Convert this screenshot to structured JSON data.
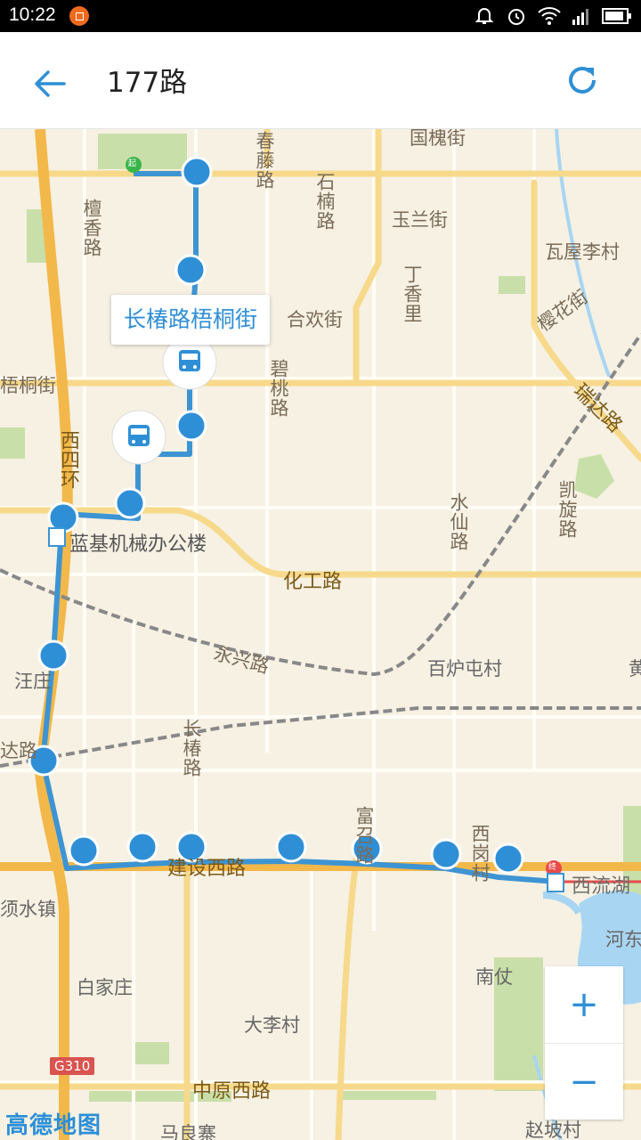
{
  "status": {
    "time": "10:22"
  },
  "header": {
    "title": "177路"
  },
  "map": {
    "callout_label": "长椿路梧桐街",
    "labels": {
      "chunteng": "春藤路",
      "danzhu": "国槐街",
      "shimei": "石楠路",
      "yulan": "玉兰街",
      "waw": "瓦屋李村",
      "tanxiang": "檀香路",
      "hehuan": "合欢街",
      "dingxiang": "丁香里",
      "yinghua": "樱花街",
      "wutong": "梧桐街",
      "ruida": "瑞达路",
      "xisihuan": "西四环",
      "bitao": "碧桃路",
      "kaixuan": "凯旋路",
      "lanji": "蓝基机械办公楼",
      "shuixian": "水仙路",
      "huagong": "化工路",
      "yongxing": "永兴路",
      "bailu": "百炉屯村",
      "huang": "黄",
      "wangzhuang": "汪庄",
      "da": "达路",
      "changchun": "长椿路",
      "fuzhai": "富召路",
      "xigang": "西岗村",
      "jianshe": "建设西路",
      "xiliuhu": "西流湖",
      "xushui": "须水镇",
      "hedong": "河东",
      "baijia": "白家庄",
      "nanzhang": "南仗",
      "dali": "大李村",
      "zhongyuan": "中原西路",
      "maliang": "马良寨",
      "zhaopo": "赵坡村",
      "g310": "G310",
      "logo": "高德地图",
      "start_mark": "起",
      "end_mark": "终"
    }
  },
  "zoom": {
    "in": "+",
    "out": "−"
  },
  "colors": {
    "accent": "#2f8fd6",
    "route": "#3d94d3"
  }
}
